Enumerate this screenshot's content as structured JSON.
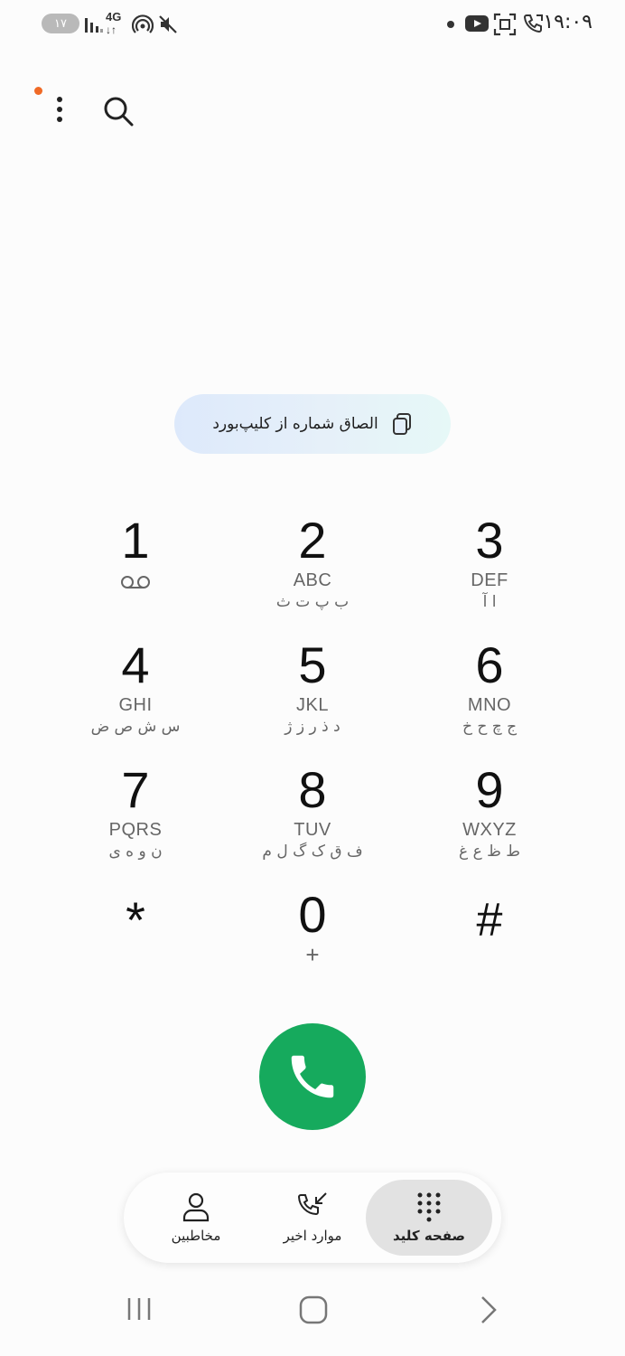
{
  "status_bar": {
    "battery": "۱۷",
    "time": "۱۹:۰۹",
    "network": "4G"
  },
  "paste_chip": {
    "label": "الصاق شماره از کلیپ‌بورد",
    "icon": "clipboard-copy-icon"
  },
  "keypad": {
    "keys": [
      {
        "digit": "1",
        "latin": "",
        "persian": "",
        "extra": "voicemail-icon"
      },
      {
        "digit": "2",
        "latin": "ABC",
        "persian": "ب پ ت ث"
      },
      {
        "digit": "3",
        "latin": "DEF",
        "persian": "ا آ"
      },
      {
        "digit": "4",
        "latin": "GHI",
        "persian": "س ش ص ض"
      },
      {
        "digit": "5",
        "latin": "JKL",
        "persian": "د ذ ر ز ژ"
      },
      {
        "digit": "6",
        "latin": "MNO",
        "persian": "ج چ ح خ"
      },
      {
        "digit": "7",
        "latin": "PQRS",
        "persian": "ن و ه ی"
      },
      {
        "digit": "8",
        "latin": "TUV",
        "persian": "ف ق ک گ ل م"
      },
      {
        "digit": "9",
        "latin": "WXYZ",
        "persian": "ط ظ ع غ"
      },
      {
        "digit": "*",
        "latin": "",
        "persian": ""
      },
      {
        "digit": "0",
        "latin": "",
        "persian": "",
        "sub": "+"
      },
      {
        "digit": "#",
        "latin": "",
        "persian": ""
      }
    ]
  },
  "call_button": {
    "icon": "phone-icon"
  },
  "bottom_nav": {
    "items": [
      {
        "label": "مخاطبین",
        "icon": "person-icon",
        "active": false
      },
      {
        "label": "موارد اخیر",
        "icon": "recent-calls-icon",
        "active": false
      },
      {
        "label": "صفحه کلید",
        "icon": "keypad-icon",
        "active": true
      }
    ]
  },
  "colors": {
    "call_green": "#16aa5d",
    "notification_dot": "#f06a26",
    "active_tab_bg": "#e2e2e2"
  }
}
